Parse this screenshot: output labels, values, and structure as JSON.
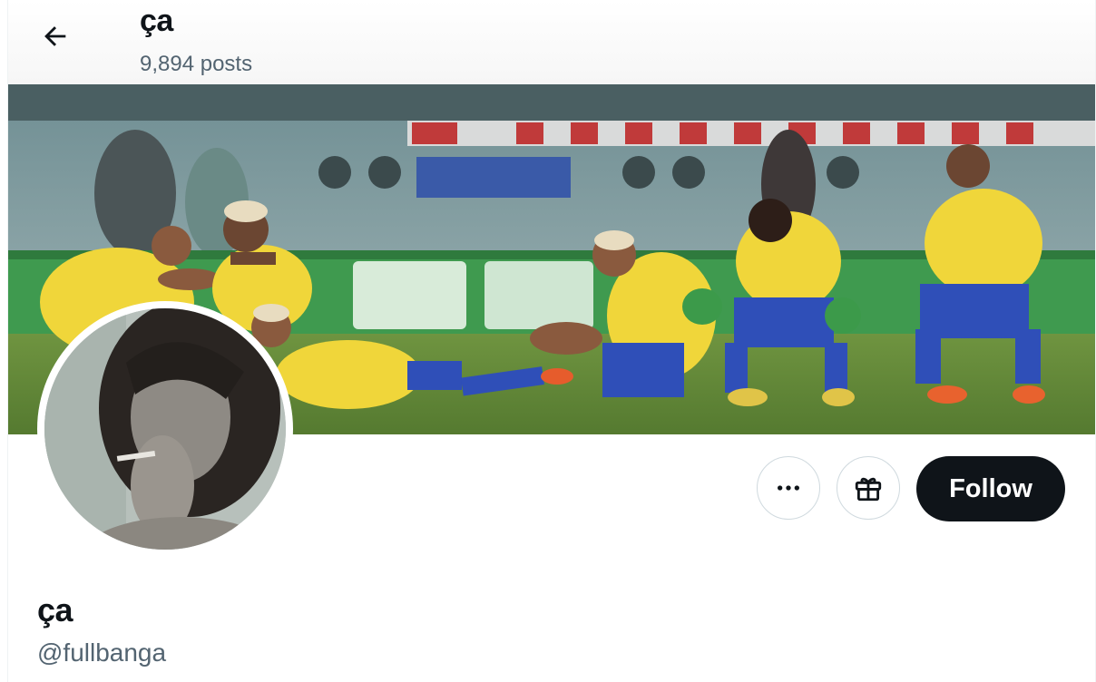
{
  "header": {
    "title": "ça",
    "posts_count": "9,894 posts"
  },
  "profile": {
    "display_name": "ça",
    "handle": "@fullbanga"
  },
  "actions": {
    "follow_label": "Follow",
    "more_icon": "more-horizontal-icon",
    "gift_icon": "gift-icon",
    "back_icon": "back-arrow-icon"
  },
  "colors": {
    "follow_bg": "#0f1419",
    "secondary_text": "#536471",
    "border": "#cfd9de"
  }
}
